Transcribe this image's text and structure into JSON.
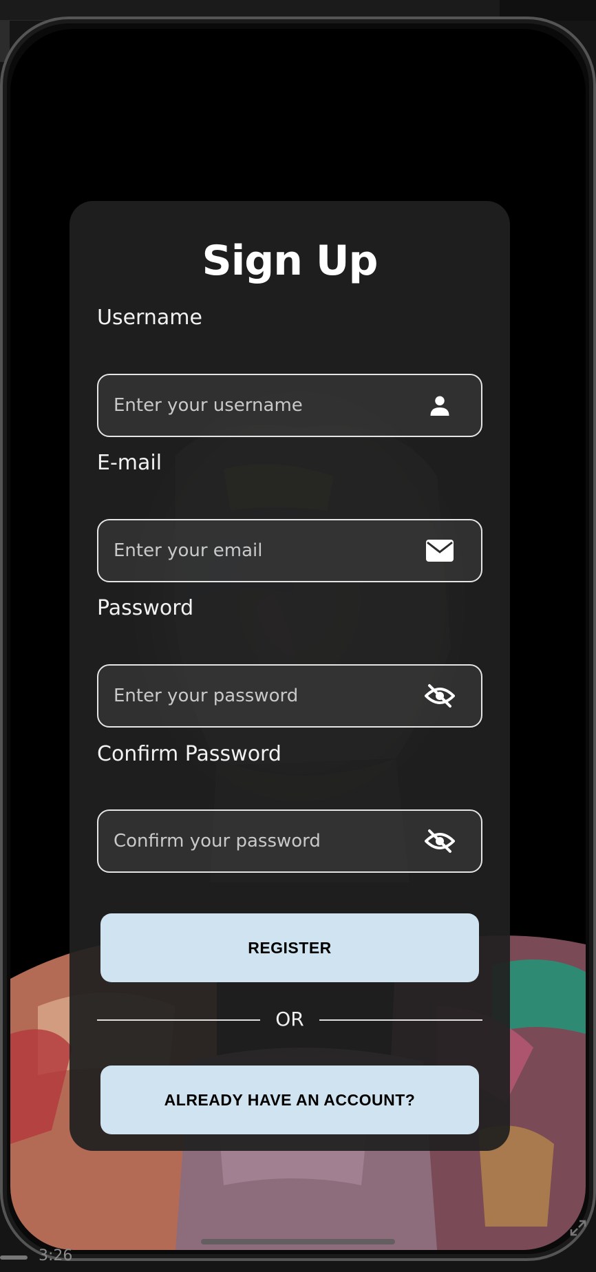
{
  "form": {
    "title": "Sign Up",
    "username": {
      "label": "Username",
      "placeholder": "Enter your username",
      "icon": "person-icon"
    },
    "email": {
      "label": "E-mail",
      "placeholder": "Enter your email",
      "icon": "mail-icon"
    },
    "password": {
      "label": "Password",
      "placeholder": "Enter your password",
      "icon": "eye-off-icon"
    },
    "confirm_password": {
      "label": "Confirm Password",
      "placeholder": "Confirm your password",
      "icon": "eye-off-icon"
    },
    "register_label": "REGISTER",
    "divider_text": "OR",
    "login_label": "ALREADY HAVE AN ACCOUNT?"
  },
  "player": {
    "time": "3:26"
  },
  "colors": {
    "card": "#202020",
    "button": "#cfe3f1",
    "screen": "#000000"
  }
}
